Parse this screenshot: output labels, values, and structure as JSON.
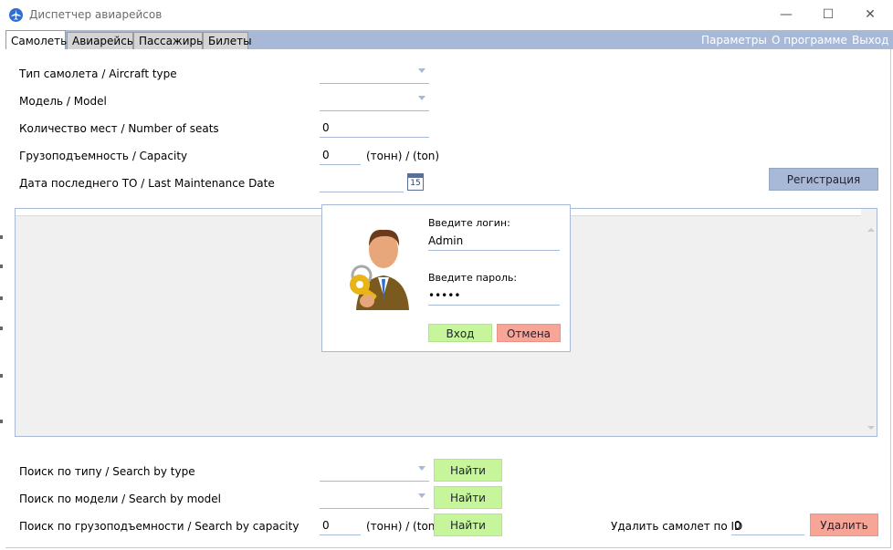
{
  "window": {
    "title": "Диспетчер авиарейсов",
    "minimize": "—",
    "maximize": "☐",
    "close": "✕"
  },
  "tabs": [
    "Самолеты",
    "Авиарейсы",
    "Пассажиры",
    "Билеты"
  ],
  "menu": {
    "params": "Параметры",
    "about": "О программе",
    "exit": "Выход"
  },
  "form": {
    "aircraft_type_label": "Тип самолета / Aircraft type",
    "model_label": "Модель / Model",
    "seats_label": "Количество мест / Number of seats",
    "seats_value": "0",
    "capacity_label": "Грузоподъемность / Capacity",
    "capacity_value": "0",
    "capacity_unit": "(тонн) / (ton)",
    "maintenance_label": "Дата последнего ТО / Last Maintenance Date",
    "calendar_day": "15",
    "register_button": "Регистрация"
  },
  "login_dialog": {
    "login_label": "Введите логин:",
    "login_value": "Admin",
    "password_label": "Введите пароль:",
    "password_value": "•••••",
    "ok_button": "Вход",
    "cancel_button": "Отмена"
  },
  "search": {
    "by_type_label": "Поиск по типу / Search by type",
    "by_model_label": "Поиск по модели / Search by model",
    "by_capacity_label": "Поиск по грузоподъемности / Search by capacity",
    "capacity_value": "0",
    "capacity_unit": "(тонн) / (ton)",
    "find_button": "Найти"
  },
  "delete": {
    "label": "Удалить самолет по ID",
    "id_value": "0",
    "button": "Удалить"
  },
  "colors": {
    "accent": "#a7b9d6",
    "green": "#c6f59c",
    "red": "#f7a597"
  }
}
